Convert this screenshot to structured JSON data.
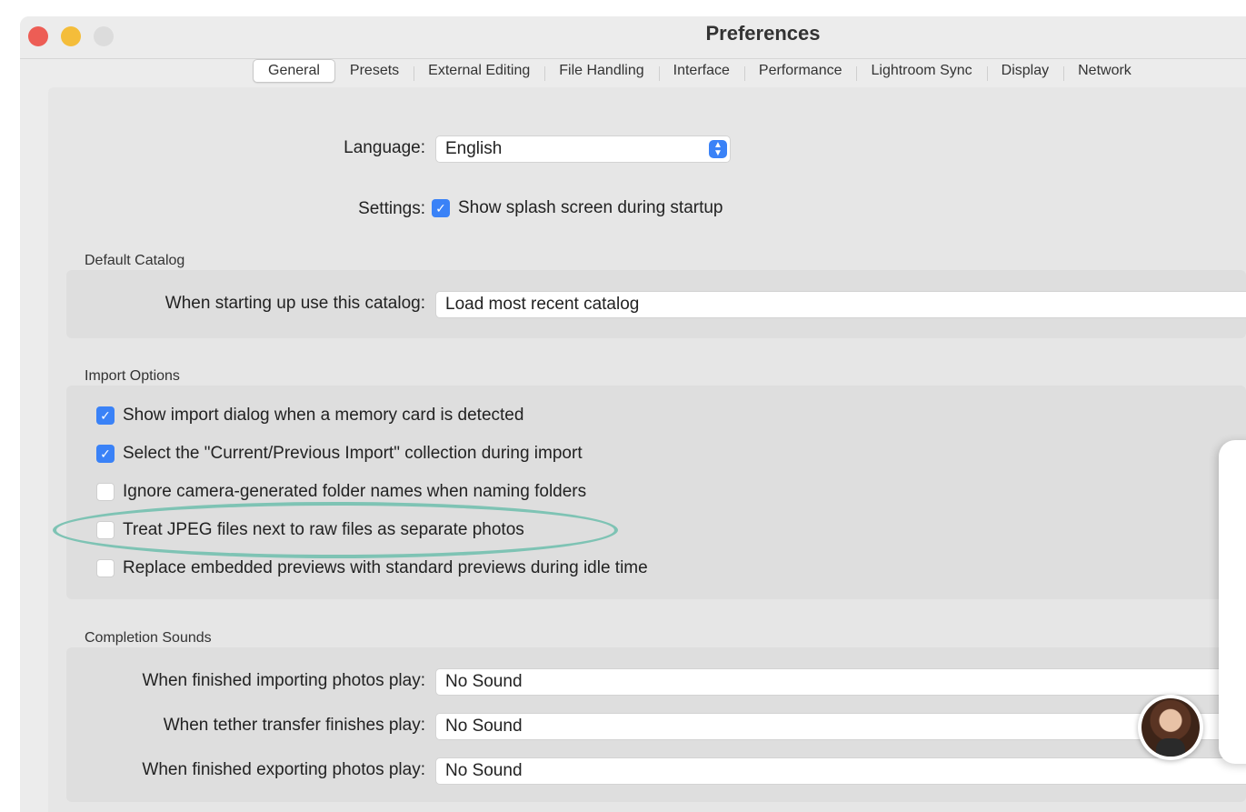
{
  "window": {
    "title": "Preferences"
  },
  "tabs": [
    {
      "label": "General",
      "active": true
    },
    {
      "label": "Presets"
    },
    {
      "label": "External Editing"
    },
    {
      "label": "File Handling"
    },
    {
      "label": "Interface"
    },
    {
      "label": "Performance"
    },
    {
      "label": "Lightroom Sync"
    },
    {
      "label": "Display"
    },
    {
      "label": "Network"
    }
  ],
  "general": {
    "language_label": "Language:",
    "language_value": "English",
    "settings_label": "Settings:",
    "splash_label": "Show splash screen during startup",
    "splash_checked": true
  },
  "default_catalog": {
    "title": "Default Catalog",
    "label": "When starting up use this catalog:",
    "value": "Load most recent catalog"
  },
  "import_options": {
    "title": "Import Options",
    "items": [
      {
        "label": "Show import dialog when a memory card is detected",
        "checked": true
      },
      {
        "label": "Select the \"Current/Previous Import\" collection during import",
        "checked": true
      },
      {
        "label": "Ignore camera-generated folder names when naming folders",
        "checked": false
      },
      {
        "label": "Treat JPEG files next to raw files as separate photos",
        "checked": false
      },
      {
        "label": "Replace embedded previews with standard previews during idle time",
        "checked": false
      }
    ]
  },
  "completion_sounds": {
    "title": "Completion Sounds",
    "rows": [
      {
        "label": "When finished importing photos play:",
        "value": "No Sound"
      },
      {
        "label": "When tether transfer finishes play:",
        "value": "No Sound"
      },
      {
        "label": "When finished exporting photos play:",
        "value": "No Sound"
      }
    ]
  },
  "colors": {
    "accent": "#3a82f7",
    "highlight": "#7ec3b4",
    "close": "#ed5d55",
    "minimize": "#f4bd3a"
  }
}
